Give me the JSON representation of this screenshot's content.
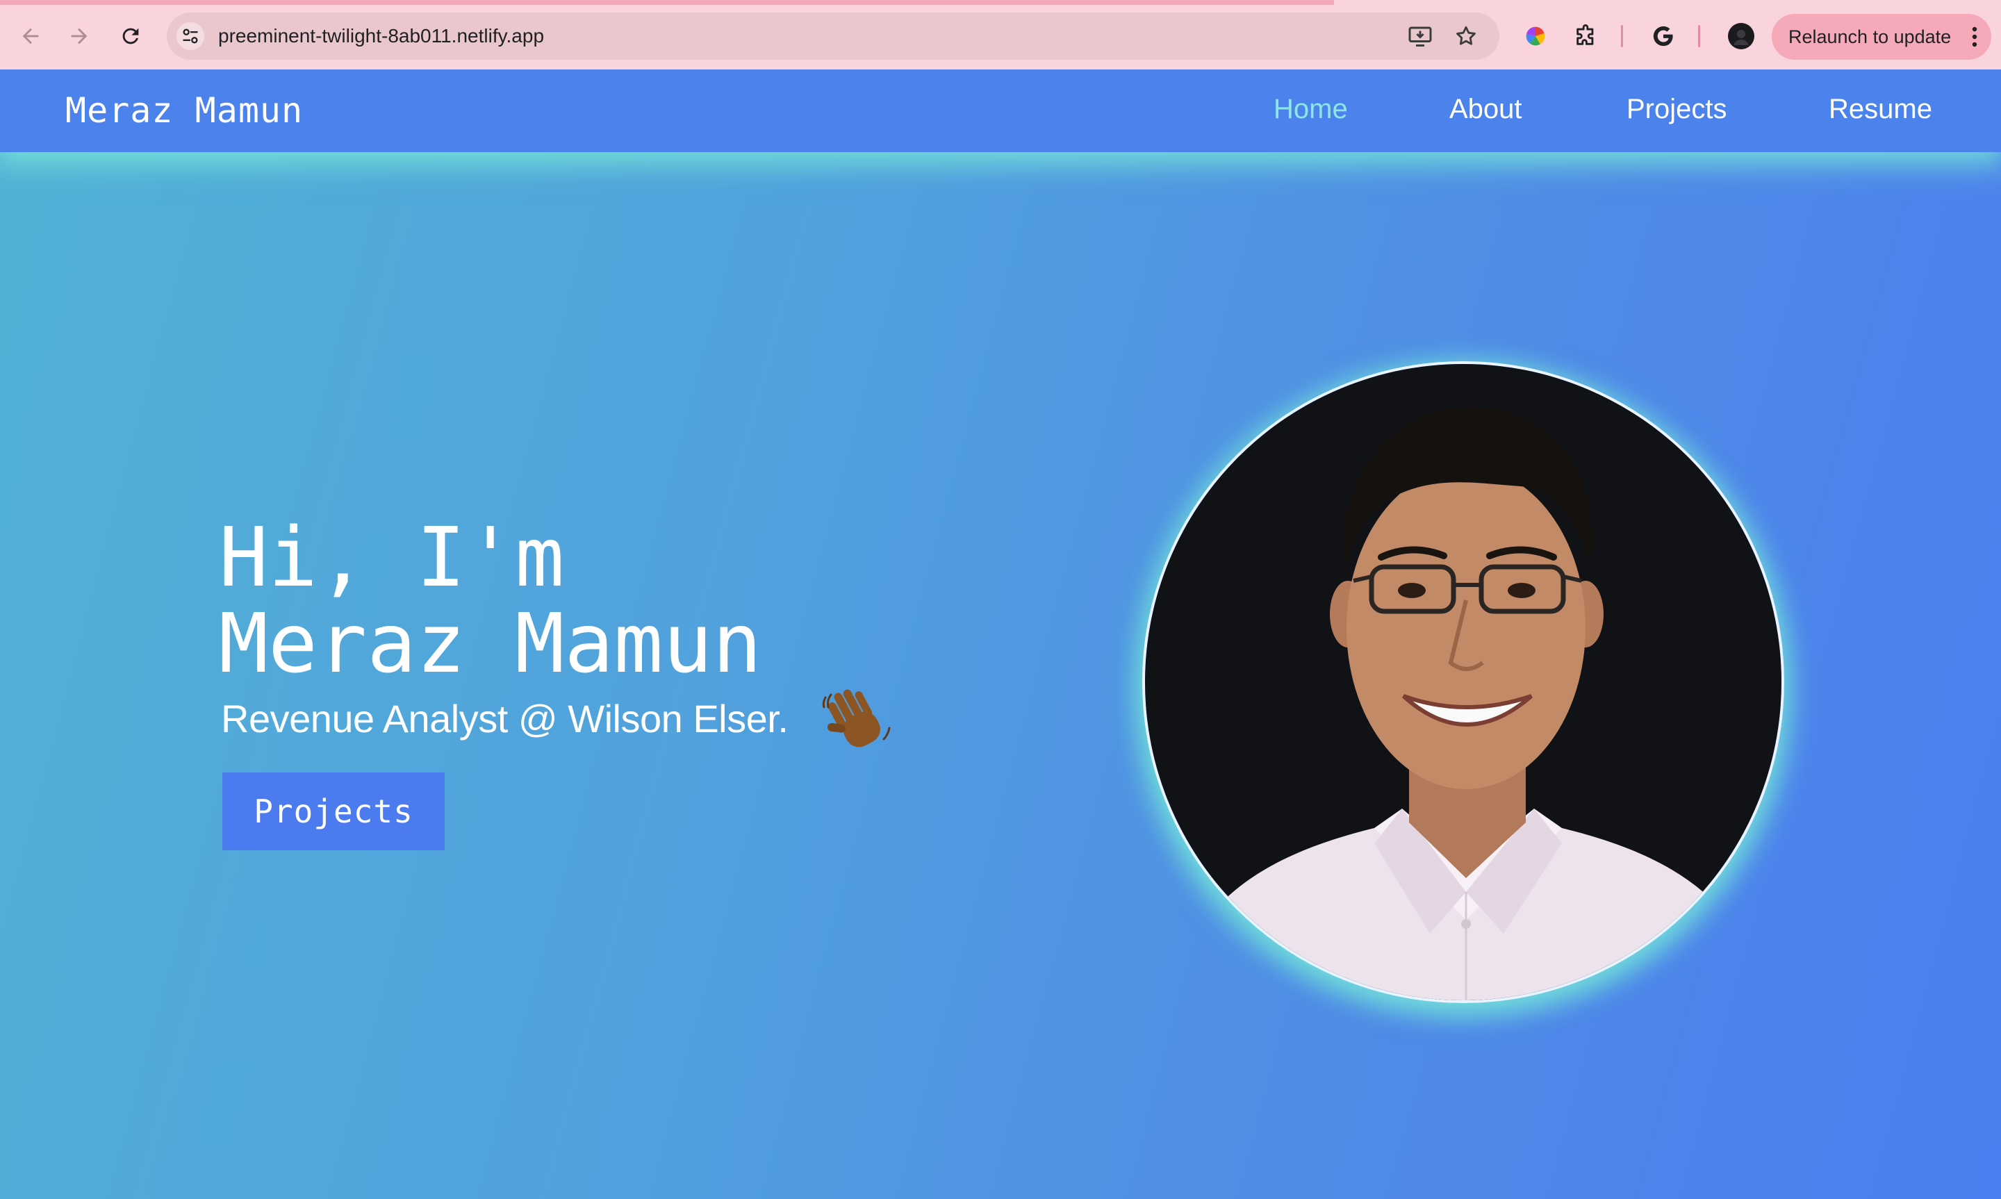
{
  "browser": {
    "url": "preeminent-twilight-8ab011.netlify.app",
    "relaunch_label": "Relaunch to update",
    "icons": {
      "back": "back-arrow-icon",
      "forward": "forward-arrow-icon",
      "reload": "reload-icon",
      "site_info": "tune-icon",
      "install": "install-app-icon",
      "bookmark": "star-icon",
      "extension_color": "color-wheel-icon",
      "extensions": "puzzle-icon",
      "google": "google-g-icon",
      "profile": "avatar",
      "menu": "kebab-menu-icon"
    },
    "colors": {
      "chrome_bg": "#f9d4dc",
      "omnibox_bg": "#e9c7cd",
      "relaunch_bg": "#f6aab9"
    }
  },
  "site": {
    "brand": "Meraz Mamun",
    "nav": [
      {
        "label": "Home",
        "active": true
      },
      {
        "label": "About",
        "active": false
      },
      {
        "label": "Projects",
        "active": false
      },
      {
        "label": "Resume",
        "active": false
      }
    ],
    "hero": {
      "line1": "Hi, I'm",
      "line2": "Meraz Mamun",
      "emoji": "waving-hand-icon",
      "subtitle": "Revenue Analyst @ Wilson Elser.",
      "cta": "Projects"
    },
    "colors": {
      "nav_bg": "#4c82ec",
      "active_link": "#8ee6e3",
      "cta_bg": "#4b7bee",
      "glow": "#78ebd7"
    }
  }
}
